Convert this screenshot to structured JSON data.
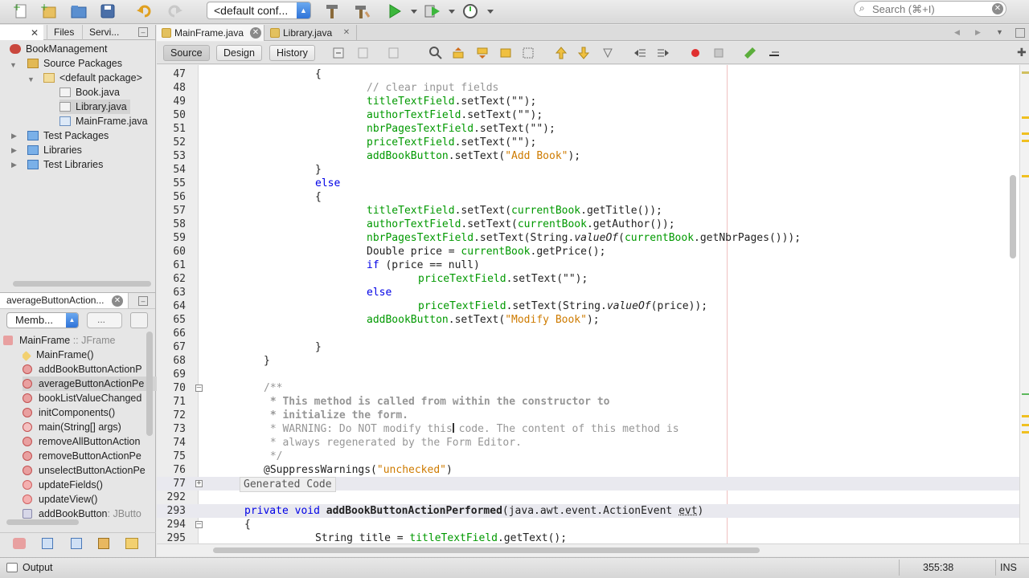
{
  "toolbar": {
    "config": "<default conf...",
    "search_placeholder": "Search (⌘+I)"
  },
  "project_panel": {
    "tabs": [
      "Files",
      "Servi..."
    ],
    "tree": {
      "project": "BookManagement",
      "source_packages": "Source Packages",
      "default_package": "<default package>",
      "files": [
        "Book.java",
        "Library.java",
        "MainFrame.java"
      ],
      "test_packages": "Test Packages",
      "libraries": "Libraries",
      "test_libraries": "Test Libraries"
    }
  },
  "navigator": {
    "title": "averageButtonAction...",
    "filter": "Memb...",
    "filter2": "...",
    "class_name": "MainFrame",
    "class_type": ":: JFrame",
    "members": [
      {
        "label": "MainFrame()",
        "sub": ""
      },
      {
        "label": "addBookButtonActionP",
        "sub": ""
      },
      {
        "label": "averageButtonActionPe",
        "sub": ""
      },
      {
        "label": "bookListValueChanged",
        "sub": ""
      },
      {
        "label": "initComponents()",
        "sub": ""
      },
      {
        "label": "main(String[] args)",
        "sub": ""
      },
      {
        "label": "removeAllButtonAction",
        "sub": ""
      },
      {
        "label": "removeButtonActionPe",
        "sub": ""
      },
      {
        "label": "unselectButtonActionPe",
        "sub": ""
      },
      {
        "label": "updateFields()",
        "sub": ""
      },
      {
        "label": "updateView()",
        "sub": ""
      },
      {
        "label": "addBookButton",
        "sub": ": JButto"
      }
    ]
  },
  "editor": {
    "tabs": [
      "MainFrame.java",
      "Library.java"
    ],
    "views": [
      "Source",
      "Design",
      "History"
    ],
    "lines": {
      "l47": "47",
      "l48": "48",
      "l49": "49",
      "l50": "50",
      "l51": "51",
      "l52": "52",
      "l53": "53",
      "l54": "54",
      "l55": "55",
      "l56": "56",
      "l57": "57",
      "l58": "58",
      "l59": "59",
      "l60": "60",
      "l61": "61",
      "l62": "62",
      "l63": "63",
      "l64": "64",
      "l65": "65",
      "l66": "66",
      "l67": "67",
      "l68": "68",
      "l69": "69",
      "l70": "70",
      "l71": "71",
      "l72": "72",
      "l73": "73",
      "l74": "74",
      "l75": "75",
      "l76": "76",
      "l77": "77",
      "l292": "292",
      "l293": "293",
      "l294": "294",
      "l295": "295"
    },
    "code": {
      "brace_open": "{",
      "brace_close": "}",
      "c48": "// clear input fields",
      "f_title": "titleTextField",
      "f_author": "authorTextField",
      "f_nbr": "nbrPagesTextField",
      "f_price": "priceTextField",
      "f_add": "addBookButton",
      "f_cur": "currentBook",
      "settext_empty": ".setText(\"\");",
      "settext_open": ".setText(",
      "s_add_book": "\"Add Book\"",
      "s_modify_book": "\"Modify Book\"",
      "paren_end": ");",
      "kw_else": "else",
      "kw_if": "if",
      "gettitle": ".getTitle());",
      "getauthor": ".getAuthor());",
      "string_prefix": "String.",
      "valueof": "valueOf",
      "getnbr": ".getNbrPages()));",
      "double_price": "Double price = ",
      "getprice": ".getPrice();",
      "price_null": " (price == null)",
      "valueof_price": "(price));",
      "valueof_paren": "(",
      "jd_open": "/**",
      "jd71": " * This method is called from within the constructor to",
      "jd72": " * initialize the form.",
      "jd73": " * WARNING: Do NOT modify this code. The content of this method is",
      "jd74": " * always regenerated by the Form Editor.",
      "jd_close": " */",
      "suppress": "@SuppressWarnings(",
      "s_unchecked": "\"unchecked\"",
      "paren_close": ")",
      "generated": "Generated Code",
      "kw_private_void": "private void",
      "method_name": "addBookButtonActionPerformed",
      "method_args": "(java.awt.event.ActionEvent ",
      "evt": "evt",
      "paren_only": ")",
      "l295_prefix": "String title = ",
      "gettext": ".getText();"
    }
  },
  "status": {
    "output": "Output",
    "position": "355:38",
    "mode": "INS"
  },
  "colors": {
    "field": "#009900",
    "string": "#ce7b00",
    "keyword": "#0000e6",
    "comment": "#969696",
    "margin": "#f0c0c0",
    "accent": "#2f73d8"
  }
}
